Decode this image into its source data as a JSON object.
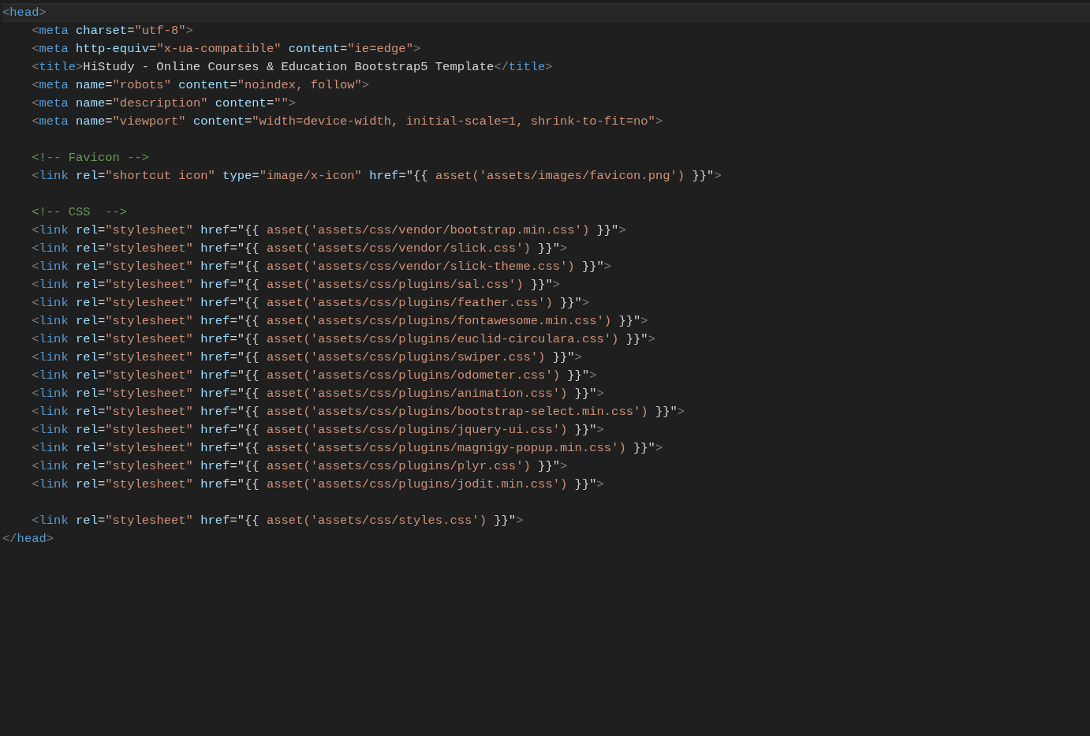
{
  "editor": {
    "lines": [
      {
        "kind": "code",
        "current": true,
        "segments": [
          {
            "kind": "punct",
            "text": "<"
          },
          {
            "kind": "tag",
            "text": "head"
          },
          {
            "kind": "punct",
            "text": ">"
          }
        ]
      },
      {
        "kind": "code",
        "current": false,
        "segments": [
          {
            "kind": "punct",
            "text": "    <"
          },
          {
            "kind": "tag",
            "text": "meta"
          },
          {
            "kind": "attr",
            "text": " charset"
          },
          {
            "kind": "plain",
            "text": "="
          },
          {
            "kind": "string",
            "text": "\"utf-8\""
          },
          {
            "kind": "punct",
            "text": ">"
          }
        ]
      },
      {
        "kind": "code",
        "current": false,
        "segments": [
          {
            "kind": "punct",
            "text": "    <"
          },
          {
            "kind": "tag",
            "text": "meta"
          },
          {
            "kind": "attr",
            "text": " http-equiv"
          },
          {
            "kind": "plain",
            "text": "="
          },
          {
            "kind": "string",
            "text": "\"x-ua-compatible\""
          },
          {
            "kind": "attr",
            "text": " content"
          },
          {
            "kind": "plain",
            "text": "="
          },
          {
            "kind": "string",
            "text": "\"ie=edge\""
          },
          {
            "kind": "punct",
            "text": ">"
          }
        ]
      },
      {
        "kind": "code",
        "current": false,
        "segments": [
          {
            "kind": "punct",
            "text": "    <"
          },
          {
            "kind": "tag",
            "text": "title"
          },
          {
            "kind": "punct",
            "text": ">"
          },
          {
            "kind": "plain",
            "text": "HiStudy - Online Courses & Education Bootstrap5 Template"
          },
          {
            "kind": "punct",
            "text": "</"
          },
          {
            "kind": "tag",
            "text": "title"
          },
          {
            "kind": "punct",
            "text": ">"
          }
        ]
      },
      {
        "kind": "code",
        "current": false,
        "segments": [
          {
            "kind": "punct",
            "text": "    <"
          },
          {
            "kind": "tag",
            "text": "meta"
          },
          {
            "kind": "attr",
            "text": " name"
          },
          {
            "kind": "plain",
            "text": "="
          },
          {
            "kind": "string",
            "text": "\"robots\""
          },
          {
            "kind": "attr",
            "text": " content"
          },
          {
            "kind": "plain",
            "text": "="
          },
          {
            "kind": "string",
            "text": "\"noindex, follow\""
          },
          {
            "kind": "punct",
            "text": ">"
          }
        ]
      },
      {
        "kind": "code",
        "current": false,
        "segments": [
          {
            "kind": "punct",
            "text": "    <"
          },
          {
            "kind": "tag",
            "text": "meta"
          },
          {
            "kind": "attr",
            "text": " name"
          },
          {
            "kind": "plain",
            "text": "="
          },
          {
            "kind": "string",
            "text": "\"description\""
          },
          {
            "kind": "attr",
            "text": " content"
          },
          {
            "kind": "plain",
            "text": "="
          },
          {
            "kind": "string",
            "text": "\"\""
          },
          {
            "kind": "punct",
            "text": ">"
          }
        ]
      },
      {
        "kind": "code",
        "current": false,
        "segments": [
          {
            "kind": "punct",
            "text": "    <"
          },
          {
            "kind": "tag",
            "text": "meta"
          },
          {
            "kind": "attr",
            "text": " name"
          },
          {
            "kind": "plain",
            "text": "="
          },
          {
            "kind": "string",
            "text": "\"viewport\""
          },
          {
            "kind": "attr",
            "text": " content"
          },
          {
            "kind": "plain",
            "text": "="
          },
          {
            "kind": "string",
            "text": "\"width=device-width, initial-scale=1, shrink-to-fit=no\""
          },
          {
            "kind": "punct",
            "text": ">"
          }
        ]
      },
      {
        "kind": "blank",
        "current": false
      },
      {
        "kind": "code",
        "current": false,
        "segments": [
          {
            "kind": "comment",
            "text": "    <!-- Favicon -->"
          }
        ]
      },
      {
        "kind": "code",
        "current": false,
        "segments": [
          {
            "kind": "punct",
            "text": "    <"
          },
          {
            "kind": "tag",
            "text": "link"
          },
          {
            "kind": "attr",
            "text": " rel"
          },
          {
            "kind": "plain",
            "text": "="
          },
          {
            "kind": "string",
            "text": "\"shortcut icon\""
          },
          {
            "kind": "attr",
            "text": " type"
          },
          {
            "kind": "plain",
            "text": "="
          },
          {
            "kind": "string",
            "text": "\"image/x-icon\""
          },
          {
            "kind": "attr",
            "text": " href"
          },
          {
            "kind": "plain",
            "text": "=\"{{ "
          },
          {
            "kind": "string",
            "text": "asset('assets/images/favicon.png')"
          },
          {
            "kind": "plain",
            "text": " }}\""
          },
          {
            "kind": "punct",
            "text": ">"
          }
        ]
      },
      {
        "kind": "blank",
        "current": false
      },
      {
        "kind": "code",
        "current": false,
        "segments": [
          {
            "kind": "comment",
            "text": "    <!-- CSS  -->"
          }
        ]
      },
      {
        "kind": "code",
        "current": false,
        "segments": [
          {
            "kind": "punct",
            "text": "    <"
          },
          {
            "kind": "tag",
            "text": "link"
          },
          {
            "kind": "attr",
            "text": " rel"
          },
          {
            "kind": "plain",
            "text": "="
          },
          {
            "kind": "string",
            "text": "\"stylesheet\""
          },
          {
            "kind": "attr",
            "text": " href"
          },
          {
            "kind": "plain",
            "text": "=\"{{ "
          },
          {
            "kind": "string",
            "text": "asset('assets/css/vendor/bootstrap.min.css')"
          },
          {
            "kind": "plain",
            "text": " }}\""
          },
          {
            "kind": "punct",
            "text": ">"
          }
        ]
      },
      {
        "kind": "code",
        "current": false,
        "segments": [
          {
            "kind": "punct",
            "text": "    <"
          },
          {
            "kind": "tag",
            "text": "link"
          },
          {
            "kind": "attr",
            "text": " rel"
          },
          {
            "kind": "plain",
            "text": "="
          },
          {
            "kind": "string",
            "text": "\"stylesheet\""
          },
          {
            "kind": "attr",
            "text": " href"
          },
          {
            "kind": "plain",
            "text": "=\"{{ "
          },
          {
            "kind": "string",
            "text": "asset('assets/css/vendor/slick.css')"
          },
          {
            "kind": "plain",
            "text": " }}\""
          },
          {
            "kind": "punct",
            "text": ">"
          }
        ]
      },
      {
        "kind": "code",
        "current": false,
        "segments": [
          {
            "kind": "punct",
            "text": "    <"
          },
          {
            "kind": "tag",
            "text": "link"
          },
          {
            "kind": "attr",
            "text": " rel"
          },
          {
            "kind": "plain",
            "text": "="
          },
          {
            "kind": "string",
            "text": "\"stylesheet\""
          },
          {
            "kind": "attr",
            "text": " href"
          },
          {
            "kind": "plain",
            "text": "=\"{{ "
          },
          {
            "kind": "string",
            "text": "asset('assets/css/vendor/slick-theme.css')"
          },
          {
            "kind": "plain",
            "text": " }}\""
          },
          {
            "kind": "punct",
            "text": ">"
          }
        ]
      },
      {
        "kind": "code",
        "current": false,
        "segments": [
          {
            "kind": "punct",
            "text": "    <"
          },
          {
            "kind": "tag",
            "text": "link"
          },
          {
            "kind": "attr",
            "text": " rel"
          },
          {
            "kind": "plain",
            "text": "="
          },
          {
            "kind": "string",
            "text": "\"stylesheet\""
          },
          {
            "kind": "attr",
            "text": " href"
          },
          {
            "kind": "plain",
            "text": "=\"{{ "
          },
          {
            "kind": "string",
            "text": "asset('assets/css/plugins/sal.css')"
          },
          {
            "kind": "plain",
            "text": " }}\""
          },
          {
            "kind": "punct",
            "text": ">"
          }
        ]
      },
      {
        "kind": "code",
        "current": false,
        "segments": [
          {
            "kind": "punct",
            "text": "    <"
          },
          {
            "kind": "tag",
            "text": "link"
          },
          {
            "kind": "attr",
            "text": " rel"
          },
          {
            "kind": "plain",
            "text": "="
          },
          {
            "kind": "string",
            "text": "\"stylesheet\""
          },
          {
            "kind": "attr",
            "text": " href"
          },
          {
            "kind": "plain",
            "text": "=\"{{ "
          },
          {
            "kind": "string",
            "text": "asset('assets/css/plugins/feather.css')"
          },
          {
            "kind": "plain",
            "text": " }}\""
          },
          {
            "kind": "punct",
            "text": ">"
          }
        ]
      },
      {
        "kind": "code",
        "current": false,
        "segments": [
          {
            "kind": "punct",
            "text": "    <"
          },
          {
            "kind": "tag",
            "text": "link"
          },
          {
            "kind": "attr",
            "text": " rel"
          },
          {
            "kind": "plain",
            "text": "="
          },
          {
            "kind": "string",
            "text": "\"stylesheet\""
          },
          {
            "kind": "attr",
            "text": " href"
          },
          {
            "kind": "plain",
            "text": "=\"{{ "
          },
          {
            "kind": "string",
            "text": "asset('assets/css/plugins/fontawesome.min.css')"
          },
          {
            "kind": "plain",
            "text": " }}\""
          },
          {
            "kind": "punct",
            "text": ">"
          }
        ]
      },
      {
        "kind": "code",
        "current": false,
        "segments": [
          {
            "kind": "punct",
            "text": "    <"
          },
          {
            "kind": "tag",
            "text": "link"
          },
          {
            "kind": "attr",
            "text": " rel"
          },
          {
            "kind": "plain",
            "text": "="
          },
          {
            "kind": "string",
            "text": "\"stylesheet\""
          },
          {
            "kind": "attr",
            "text": " href"
          },
          {
            "kind": "plain",
            "text": "=\"{{ "
          },
          {
            "kind": "string",
            "text": "asset('assets/css/plugins/euclid-circulara.css')"
          },
          {
            "kind": "plain",
            "text": " }}\""
          },
          {
            "kind": "punct",
            "text": ">"
          }
        ]
      },
      {
        "kind": "code",
        "current": false,
        "segments": [
          {
            "kind": "punct",
            "text": "    <"
          },
          {
            "kind": "tag",
            "text": "link"
          },
          {
            "kind": "attr",
            "text": " rel"
          },
          {
            "kind": "plain",
            "text": "="
          },
          {
            "kind": "string",
            "text": "\"stylesheet\""
          },
          {
            "kind": "attr",
            "text": " href"
          },
          {
            "kind": "plain",
            "text": "=\"{{ "
          },
          {
            "kind": "string",
            "text": "asset('assets/css/plugins/swiper.css')"
          },
          {
            "kind": "plain",
            "text": " }}\""
          },
          {
            "kind": "punct",
            "text": ">"
          }
        ]
      },
      {
        "kind": "code",
        "current": false,
        "segments": [
          {
            "kind": "punct",
            "text": "    <"
          },
          {
            "kind": "tag",
            "text": "link"
          },
          {
            "kind": "attr",
            "text": " rel"
          },
          {
            "kind": "plain",
            "text": "="
          },
          {
            "kind": "string",
            "text": "\"stylesheet\""
          },
          {
            "kind": "attr",
            "text": " href"
          },
          {
            "kind": "plain",
            "text": "=\"{{ "
          },
          {
            "kind": "string",
            "text": "asset('assets/css/plugins/odometer.css')"
          },
          {
            "kind": "plain",
            "text": " }}\""
          },
          {
            "kind": "punct",
            "text": ">"
          }
        ]
      },
      {
        "kind": "code",
        "current": false,
        "segments": [
          {
            "kind": "punct",
            "text": "    <"
          },
          {
            "kind": "tag",
            "text": "link"
          },
          {
            "kind": "attr",
            "text": " rel"
          },
          {
            "kind": "plain",
            "text": "="
          },
          {
            "kind": "string",
            "text": "\"stylesheet\""
          },
          {
            "kind": "attr",
            "text": " href"
          },
          {
            "kind": "plain",
            "text": "=\"{{ "
          },
          {
            "kind": "string",
            "text": "asset('assets/css/plugins/animation.css')"
          },
          {
            "kind": "plain",
            "text": " }}\""
          },
          {
            "kind": "punct",
            "text": ">"
          }
        ]
      },
      {
        "kind": "code",
        "current": false,
        "segments": [
          {
            "kind": "punct",
            "text": "    <"
          },
          {
            "kind": "tag",
            "text": "link"
          },
          {
            "kind": "attr",
            "text": " rel"
          },
          {
            "kind": "plain",
            "text": "="
          },
          {
            "kind": "string",
            "text": "\"stylesheet\""
          },
          {
            "kind": "attr",
            "text": " href"
          },
          {
            "kind": "plain",
            "text": "=\"{{ "
          },
          {
            "kind": "string",
            "text": "asset('assets/css/plugins/bootstrap-select.min.css')"
          },
          {
            "kind": "plain",
            "text": " }}\""
          },
          {
            "kind": "punct",
            "text": ">"
          }
        ]
      },
      {
        "kind": "code",
        "current": false,
        "segments": [
          {
            "kind": "punct",
            "text": "    <"
          },
          {
            "kind": "tag",
            "text": "link"
          },
          {
            "kind": "attr",
            "text": " rel"
          },
          {
            "kind": "plain",
            "text": "="
          },
          {
            "kind": "string",
            "text": "\"stylesheet\""
          },
          {
            "kind": "attr",
            "text": " href"
          },
          {
            "kind": "plain",
            "text": "=\"{{ "
          },
          {
            "kind": "string",
            "text": "asset('assets/css/plugins/jquery-ui.css')"
          },
          {
            "kind": "plain",
            "text": " }}\""
          },
          {
            "kind": "punct",
            "text": ">"
          }
        ]
      },
      {
        "kind": "code",
        "current": false,
        "segments": [
          {
            "kind": "punct",
            "text": "    <"
          },
          {
            "kind": "tag",
            "text": "link"
          },
          {
            "kind": "attr",
            "text": " rel"
          },
          {
            "kind": "plain",
            "text": "="
          },
          {
            "kind": "string",
            "text": "\"stylesheet\""
          },
          {
            "kind": "attr",
            "text": " href"
          },
          {
            "kind": "plain",
            "text": "=\"{{ "
          },
          {
            "kind": "string",
            "text": "asset('assets/css/plugins/magnigy-popup.min.css')"
          },
          {
            "kind": "plain",
            "text": " }}\""
          },
          {
            "kind": "punct",
            "text": ">"
          }
        ]
      },
      {
        "kind": "code",
        "current": false,
        "segments": [
          {
            "kind": "punct",
            "text": "    <"
          },
          {
            "kind": "tag",
            "text": "link"
          },
          {
            "kind": "attr",
            "text": " rel"
          },
          {
            "kind": "plain",
            "text": "="
          },
          {
            "kind": "string",
            "text": "\"stylesheet\""
          },
          {
            "kind": "attr",
            "text": " href"
          },
          {
            "kind": "plain",
            "text": "=\"{{ "
          },
          {
            "kind": "string",
            "text": "asset('assets/css/plugins/plyr.css')"
          },
          {
            "kind": "plain",
            "text": " }}\""
          },
          {
            "kind": "punct",
            "text": ">"
          }
        ]
      },
      {
        "kind": "code",
        "current": false,
        "segments": [
          {
            "kind": "punct",
            "text": "    <"
          },
          {
            "kind": "tag",
            "text": "link"
          },
          {
            "kind": "attr",
            "text": " rel"
          },
          {
            "kind": "plain",
            "text": "="
          },
          {
            "kind": "string",
            "text": "\"stylesheet\""
          },
          {
            "kind": "attr",
            "text": " href"
          },
          {
            "kind": "plain",
            "text": "=\"{{ "
          },
          {
            "kind": "string",
            "text": "asset('assets/css/plugins/jodit.min.css')"
          },
          {
            "kind": "plain",
            "text": " }}\""
          },
          {
            "kind": "punct",
            "text": ">"
          }
        ]
      },
      {
        "kind": "blank",
        "current": false
      },
      {
        "kind": "code",
        "current": false,
        "segments": [
          {
            "kind": "punct",
            "text": "    <"
          },
          {
            "kind": "tag",
            "text": "link"
          },
          {
            "kind": "attr",
            "text": " rel"
          },
          {
            "kind": "plain",
            "text": "="
          },
          {
            "kind": "string",
            "text": "\"stylesheet\""
          },
          {
            "kind": "attr",
            "text": " href"
          },
          {
            "kind": "plain",
            "text": "=\"{{ "
          },
          {
            "kind": "string",
            "text": "asset('assets/css/styles.css')"
          },
          {
            "kind": "plain",
            "text": " }}\""
          },
          {
            "kind": "punct",
            "text": ">"
          }
        ]
      },
      {
        "kind": "code",
        "current": false,
        "segments": [
          {
            "kind": "punct",
            "text": "</"
          },
          {
            "kind": "tag",
            "text": "head"
          },
          {
            "kind": "punct",
            "text": ">"
          }
        ]
      }
    ]
  }
}
